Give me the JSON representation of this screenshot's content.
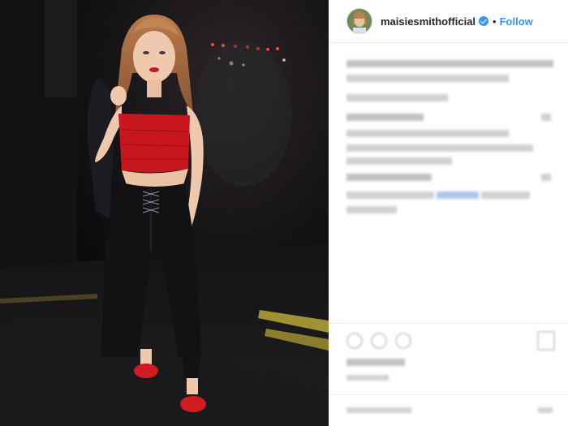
{
  "post": {
    "username": "maisiesmithofficial",
    "separator": "•",
    "follow_label": "Follow",
    "verified": true
  },
  "icons": {
    "avatar": "avatar-photo",
    "verified": "verified-badge-icon",
    "like": "heart-icon",
    "comment": "comment-icon",
    "share": "share-icon",
    "save": "bookmark-icon"
  },
  "colors": {
    "follow_blue": "#3897f0",
    "photo_background": "#0c0b0d",
    "top_red": "#c8161d"
  }
}
